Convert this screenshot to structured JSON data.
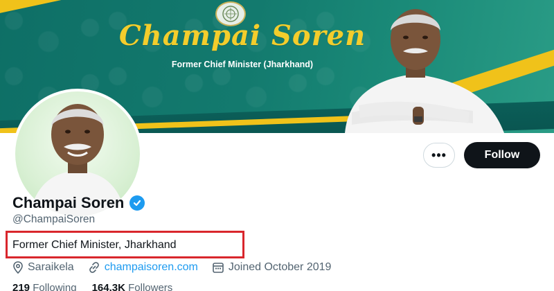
{
  "banner": {
    "title": "Champai Soren",
    "subtitle": "Former Chief Minister (Jharkhand)",
    "emblem": "state-emblem-seal",
    "colors": {
      "teal": "#137a6e",
      "gold": "#f3cd2c"
    }
  },
  "actions": {
    "more_label": "•••",
    "follow_label": "Follow"
  },
  "profile": {
    "name": "Champai Soren",
    "handle": "@ChampaiSoren",
    "verified": true,
    "bio": "Former Chief Minister, Jharkhand",
    "location": "Saraikela",
    "website": "champaisoren.com",
    "joined": "Joined October 2019",
    "following_count": "219",
    "following_label": "Following",
    "followers_count": "164.3K",
    "followers_label": "Followers"
  },
  "icons": {
    "location": "location-pin-icon",
    "link": "link-icon",
    "calendar": "calendar-icon",
    "verified": "verified-badge-icon"
  },
  "highlight": {
    "color": "#d9262c"
  }
}
